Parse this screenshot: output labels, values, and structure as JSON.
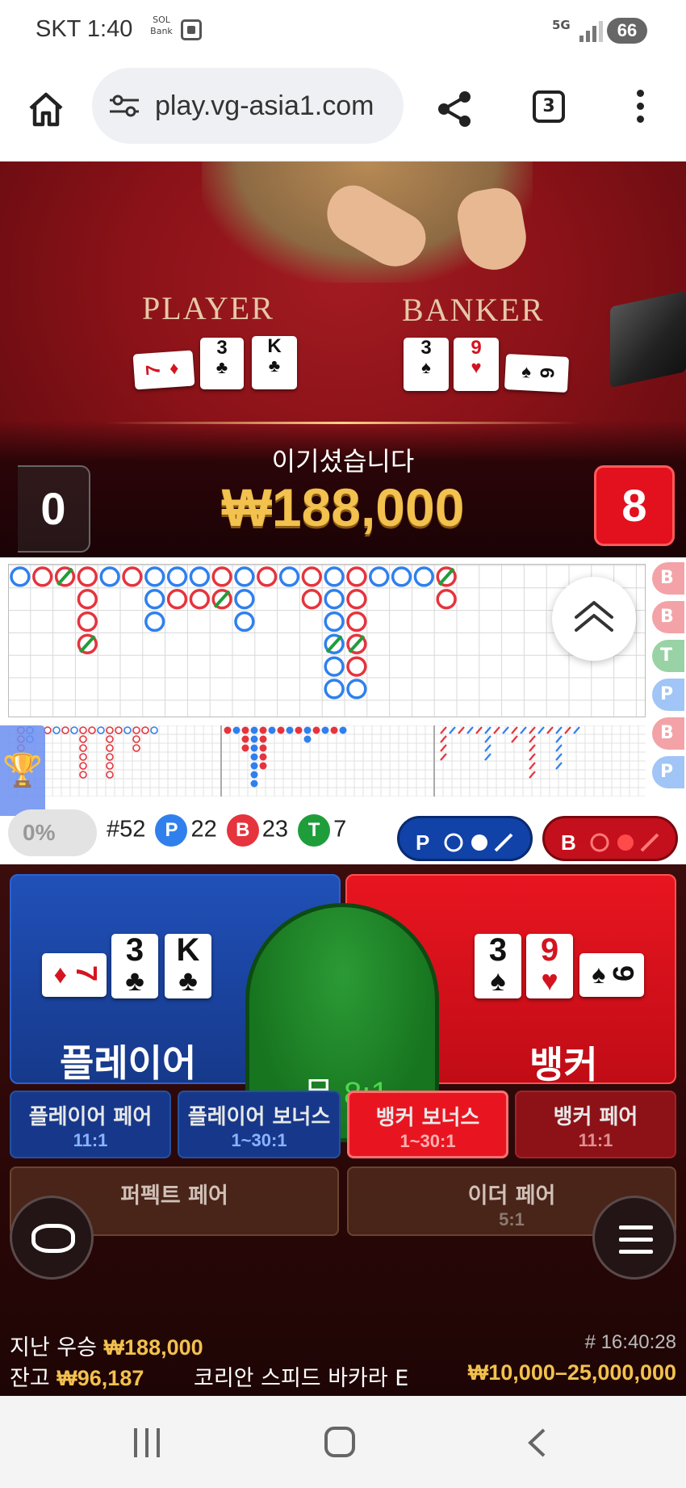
{
  "status_bar": {
    "carrier_time": "SKT 1:40",
    "bank_app_icon": "sol-bank-icon",
    "network": "5G",
    "battery": "66"
  },
  "browser": {
    "url": "play.vg-asia1.com",
    "tab_count": "3"
  },
  "live": {
    "player_label": "PLAYER",
    "banker_label": "BANKER",
    "player_cards": [
      {
        "rank": "7",
        "suit": "♦",
        "color": "red",
        "rotated": true
      },
      {
        "rank": "3",
        "suit": "♣",
        "color": "black"
      },
      {
        "rank": "K",
        "suit": "♣",
        "color": "black"
      }
    ],
    "banker_cards": [
      {
        "rank": "3",
        "suit": "♠",
        "color": "black"
      },
      {
        "rank": "9",
        "suit": "♥",
        "color": "red"
      },
      {
        "rank": "6",
        "suit": "♠",
        "color": "black",
        "rotated": true
      }
    ],
    "win_message": "이기셨습니다",
    "win_amount": "₩188,000",
    "player_score": "0",
    "banker_score": "8"
  },
  "roadmap": {
    "shoe_count": "#52",
    "player_count": "22",
    "banker_count": "23",
    "tie_count": "7",
    "win_percent": "0%",
    "player_badge": "P",
    "banker_badge": "B",
    "tie_badge": "T",
    "edge_labels": [
      "B",
      "B",
      "T",
      "P",
      "B",
      "P"
    ],
    "colors": {
      "player": "#2f80ed",
      "banker": "#e5343d",
      "tie": "#1f9d3a"
    }
  },
  "betting": {
    "player_label": "플레이어",
    "banker_label": "뱅커",
    "tie_label": "무",
    "tie_odds": "8:1",
    "side_bets": [
      {
        "name": "플레이어 페어",
        "odds": "11:1"
      },
      {
        "name": "플레이어 보너스",
        "odds": "1~30:1"
      },
      {
        "name": "뱅커 보너스",
        "odds": "1~30:1"
      },
      {
        "name": "뱅커 페어",
        "odds": "11:1"
      }
    ],
    "perfect_pair": "퍼펙트 페어",
    "either_pair": "이더 페어",
    "either_pair_odds": "5:1"
  },
  "footer": {
    "last_win_label": "지난 우승",
    "last_win_amount": "₩188,000",
    "balance_label": "잔고",
    "balance_amount": "₩96,187",
    "round_time": "# 16:40:28",
    "table_name": "코리안 스피드 바카라 E",
    "bet_limit": "₩10,000–25,000,000"
  }
}
